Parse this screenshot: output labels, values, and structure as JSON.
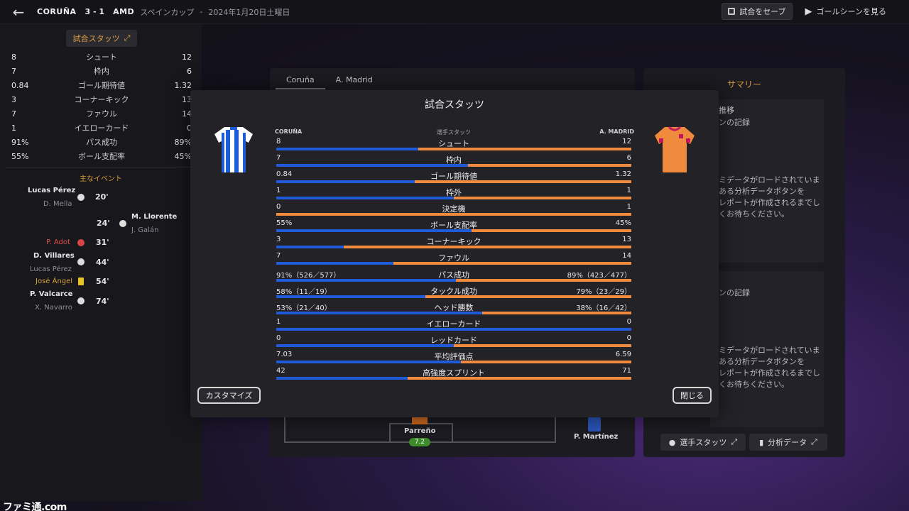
{
  "header": {
    "home_team": "CORUÑA",
    "score": "3 - 1",
    "away_team": "AMD",
    "competition": "スペインカップ",
    "separator": "-",
    "date": "2024年1月20日土曜日",
    "save_label": "試合をセーブ",
    "highlights_label": "ゴールシーンを見る"
  },
  "sidebar": {
    "stats_button": "試合スタッツ",
    "stats": [
      {
        "home": "8",
        "name": "シュート",
        "away": "12"
      },
      {
        "home": "7",
        "name": "枠内",
        "away": "6"
      },
      {
        "home": "0.84",
        "name": "ゴール期待値",
        "away": "1.32"
      },
      {
        "home": "3",
        "name": "コーナーキック",
        "away": "13"
      },
      {
        "home": "7",
        "name": "ファウル",
        "away": "14"
      },
      {
        "home": "1",
        "name": "イエローカード",
        "away": "0"
      },
      {
        "home": "91%",
        "name": "パス成功",
        "away": "89%"
      },
      {
        "home": "55%",
        "name": "ボール支配率",
        "away": "45%"
      }
    ],
    "events_title": "主なイベント",
    "events": [
      {
        "player": "Lucas Pérez",
        "assist": "D. Mella",
        "minute": "20'"
      },
      {
        "player": "M. Llorente",
        "assist": "J. Galán",
        "minute": "24'"
      },
      {
        "player": "P. Adot",
        "minute": "31'"
      },
      {
        "player": "D. Villares",
        "assist": "Lucas Pérez",
        "minute": "44'"
      },
      {
        "player": "José Ángel",
        "minute": "54'"
      },
      {
        "player": "P. Valcarce",
        "assist": "X. Navarro",
        "minute": "74'"
      }
    ]
  },
  "background": {
    "tabs": [
      "Coruña",
      "A. Madrid"
    ],
    "summary_title": "サマリー",
    "card1_title": "推移",
    "card1_sub": "ンの記録",
    "card1_body": [
      "ミデータがロードされていま",
      "ある分析データボタンを",
      "レポートが作成されるまでし",
      "くお待ちください。"
    ],
    "card2_sub": "ンの記録",
    "card2_body": [
      "ミデータがロードされていま",
      "ある分析データボタンを",
      "レポートが作成されるまでし",
      "くお待ちください。"
    ],
    "player_stats_btn": "選手スタッツ",
    "analysis_btn": "分析データ",
    "player_name": "Parreño",
    "player_rating": "7.2",
    "bench_player": "P. Martínez"
  },
  "modal": {
    "title": "試合スタッツ",
    "home_label": "CORUÑA",
    "middle_label": "選手スタッツ",
    "away_label": "A. MADRID",
    "customize_label": "カスタマイズ",
    "close_label": "閉じる",
    "home_color": "#1f5bd8",
    "away_color": "#f08a3c",
    "stats": [
      {
        "home": "8",
        "name": "シュート",
        "away": "12",
        "share": 0.4
      },
      {
        "home": "7",
        "name": "枠内",
        "away": "6",
        "share": 0.54
      },
      {
        "home": "0.84",
        "name": "ゴール期待値",
        "away": "1.32",
        "share": 0.39
      },
      {
        "home": "1",
        "name": "枠外",
        "away": "1",
        "share": 0.5
      },
      {
        "home": "0",
        "name": "決定機",
        "away": "1",
        "share": 0.0
      },
      {
        "home": "55%",
        "name": "ボール支配率",
        "away": "45%",
        "share": 0.55
      },
      {
        "home": "3",
        "name": "コーナーキック",
        "away": "13",
        "share": 0.19
      },
      {
        "home": "7",
        "name": "ファウル",
        "away": "14",
        "share": 0.33
      },
      {
        "home": "91%（526／577）",
        "name": "パス成功",
        "away": "89%（423／477）",
        "share": 0.505
      },
      {
        "home": "58%（11／19）",
        "name": "タックル成功",
        "away": "79%（23／29）",
        "share": 0.42
      },
      {
        "home": "53%（21／40）",
        "name": "ヘッド勝数",
        "away": "38%（16／42）",
        "share": 0.58
      },
      {
        "home": "1",
        "name": "イエローカード",
        "away": "0",
        "share": 1.0
      },
      {
        "home": "0",
        "name": "レッドカード",
        "away": "0",
        "share": 0.5
      },
      {
        "home": "7.03",
        "name": "平均評価点",
        "away": "6.59",
        "share": 0.52
      },
      {
        "home": "42",
        "name": "高強度スプリント",
        "away": "71",
        "share": 0.37
      }
    ]
  },
  "watermark": "ファミ通.com"
}
